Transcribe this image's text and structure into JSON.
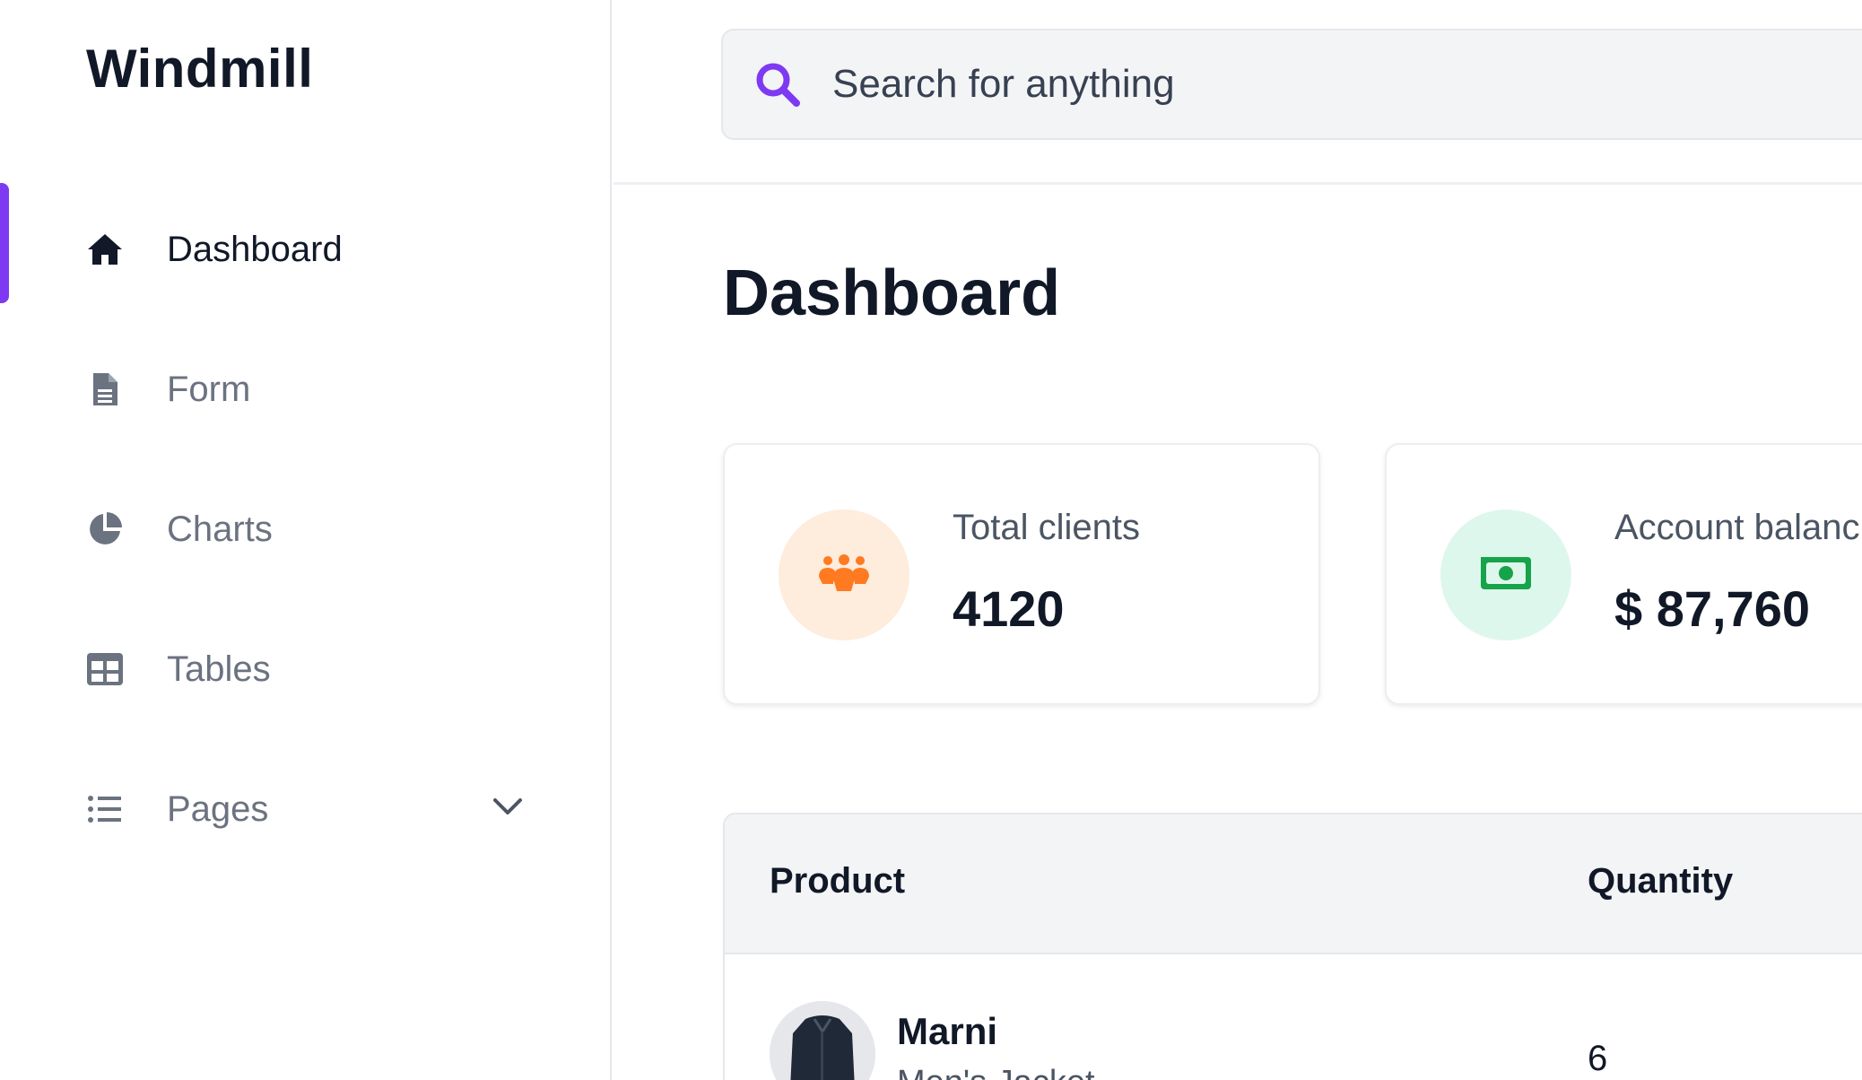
{
  "sidebar": {
    "brand": "Windmill",
    "items": [
      {
        "label": "Dashboard",
        "icon": "home-icon",
        "active": true
      },
      {
        "label": "Form",
        "icon": "document-icon",
        "active": false
      },
      {
        "label": "Charts",
        "icon": "pie-chart-icon",
        "active": false
      },
      {
        "label": "Tables",
        "icon": "table-icon",
        "active": false
      },
      {
        "label": "Pages",
        "icon": "list-icon",
        "active": false,
        "expandable": true
      }
    ]
  },
  "header": {
    "search_placeholder": "Search for anything"
  },
  "main": {
    "title": "Dashboard",
    "cards": [
      {
        "label": "Total clients",
        "value": "4120",
        "icon": "users-icon",
        "accent": "#ff8a4c",
        "badge_bg": "#feecdc"
      },
      {
        "label": "Account balanc",
        "value": "$ 87,760",
        "icon": "cash-icon",
        "accent": "#0e9f6e",
        "badge_bg": "#def7ec"
      }
    ],
    "table": {
      "columns": [
        "Product",
        "Quantity"
      ],
      "rows": [
        {
          "name": "Marni",
          "subtitle": "Men's Jacket",
          "quantity": "6"
        }
      ]
    }
  },
  "colors": {
    "primary": "#7e3af2",
    "text": "#111827",
    "muted": "#6b7280"
  }
}
